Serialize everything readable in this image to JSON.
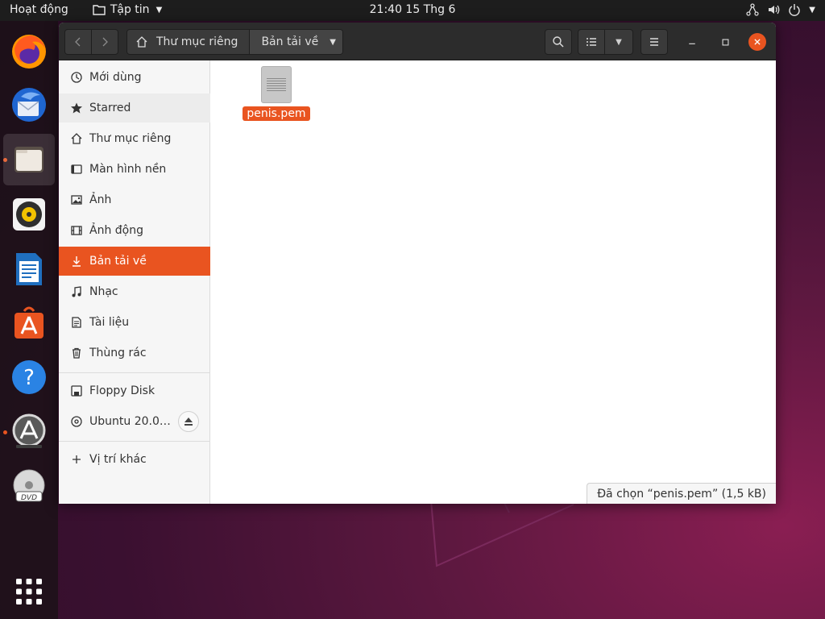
{
  "topbar": {
    "activities": "Hoạt động",
    "app_menu": "Tập tin",
    "clock": "21:40  15 Thg 6"
  },
  "dock": {
    "items": [
      {
        "name": "Firefox",
        "icon": "firefox-icon"
      },
      {
        "name": "Thunderbird",
        "icon": "thunderbird-icon"
      },
      {
        "name": "Files",
        "icon": "files-icon",
        "active": true
      },
      {
        "name": "Rhythmbox",
        "icon": "rhythmbox-icon"
      },
      {
        "name": "LibreOffice Writer",
        "icon": "writer-icon"
      },
      {
        "name": "Ubuntu Software",
        "icon": "software-icon"
      },
      {
        "name": "Help",
        "icon": "help-icon"
      },
      {
        "name": "Software Updater",
        "icon": "updater-icon"
      },
      {
        "name": "DVD",
        "icon": "dvd-icon"
      },
      {
        "name": "Show Applications",
        "icon": "app-grid-icon"
      }
    ]
  },
  "path": {
    "home": "Thư mục riêng",
    "current": "Bản tải về"
  },
  "sidebar": {
    "items": [
      {
        "label": "Mới dùng",
        "icon": "recent-icon"
      },
      {
        "label": "Starred",
        "icon": "star-icon"
      },
      {
        "label": "Thư mục riêng",
        "icon": "home-icon"
      },
      {
        "label": "Màn hình nền",
        "icon": "desktop-icon"
      },
      {
        "label": "Ảnh",
        "icon": "pictures-icon"
      },
      {
        "label": "Ảnh động",
        "icon": "videos-icon"
      },
      {
        "label": "Bản tải về",
        "icon": "downloads-icon",
        "selected": true
      },
      {
        "label": "Nhạc",
        "icon": "music-icon"
      },
      {
        "label": "Tài liệu",
        "icon": "documents-icon"
      },
      {
        "label": "Thùng rác",
        "icon": "trash-icon"
      }
    ],
    "devices": [
      {
        "label": "Floppy Disk",
        "icon": "floppy-icon"
      },
      {
        "label": "Ubuntu 20.0…",
        "icon": "disc-icon"
      }
    ],
    "other": {
      "label": "Vị trí khác",
      "icon": "plus-icon"
    }
  },
  "files": [
    {
      "name": "penis.pem",
      "icon": "text-file-icon",
      "selected": true
    }
  ],
  "status": "Đã chọn “penis.pem”  (1,5 kB)",
  "colors": {
    "accent": "#e95420",
    "headerbar": "#2c2c2c",
    "sidebar": "#f6f6f6"
  }
}
